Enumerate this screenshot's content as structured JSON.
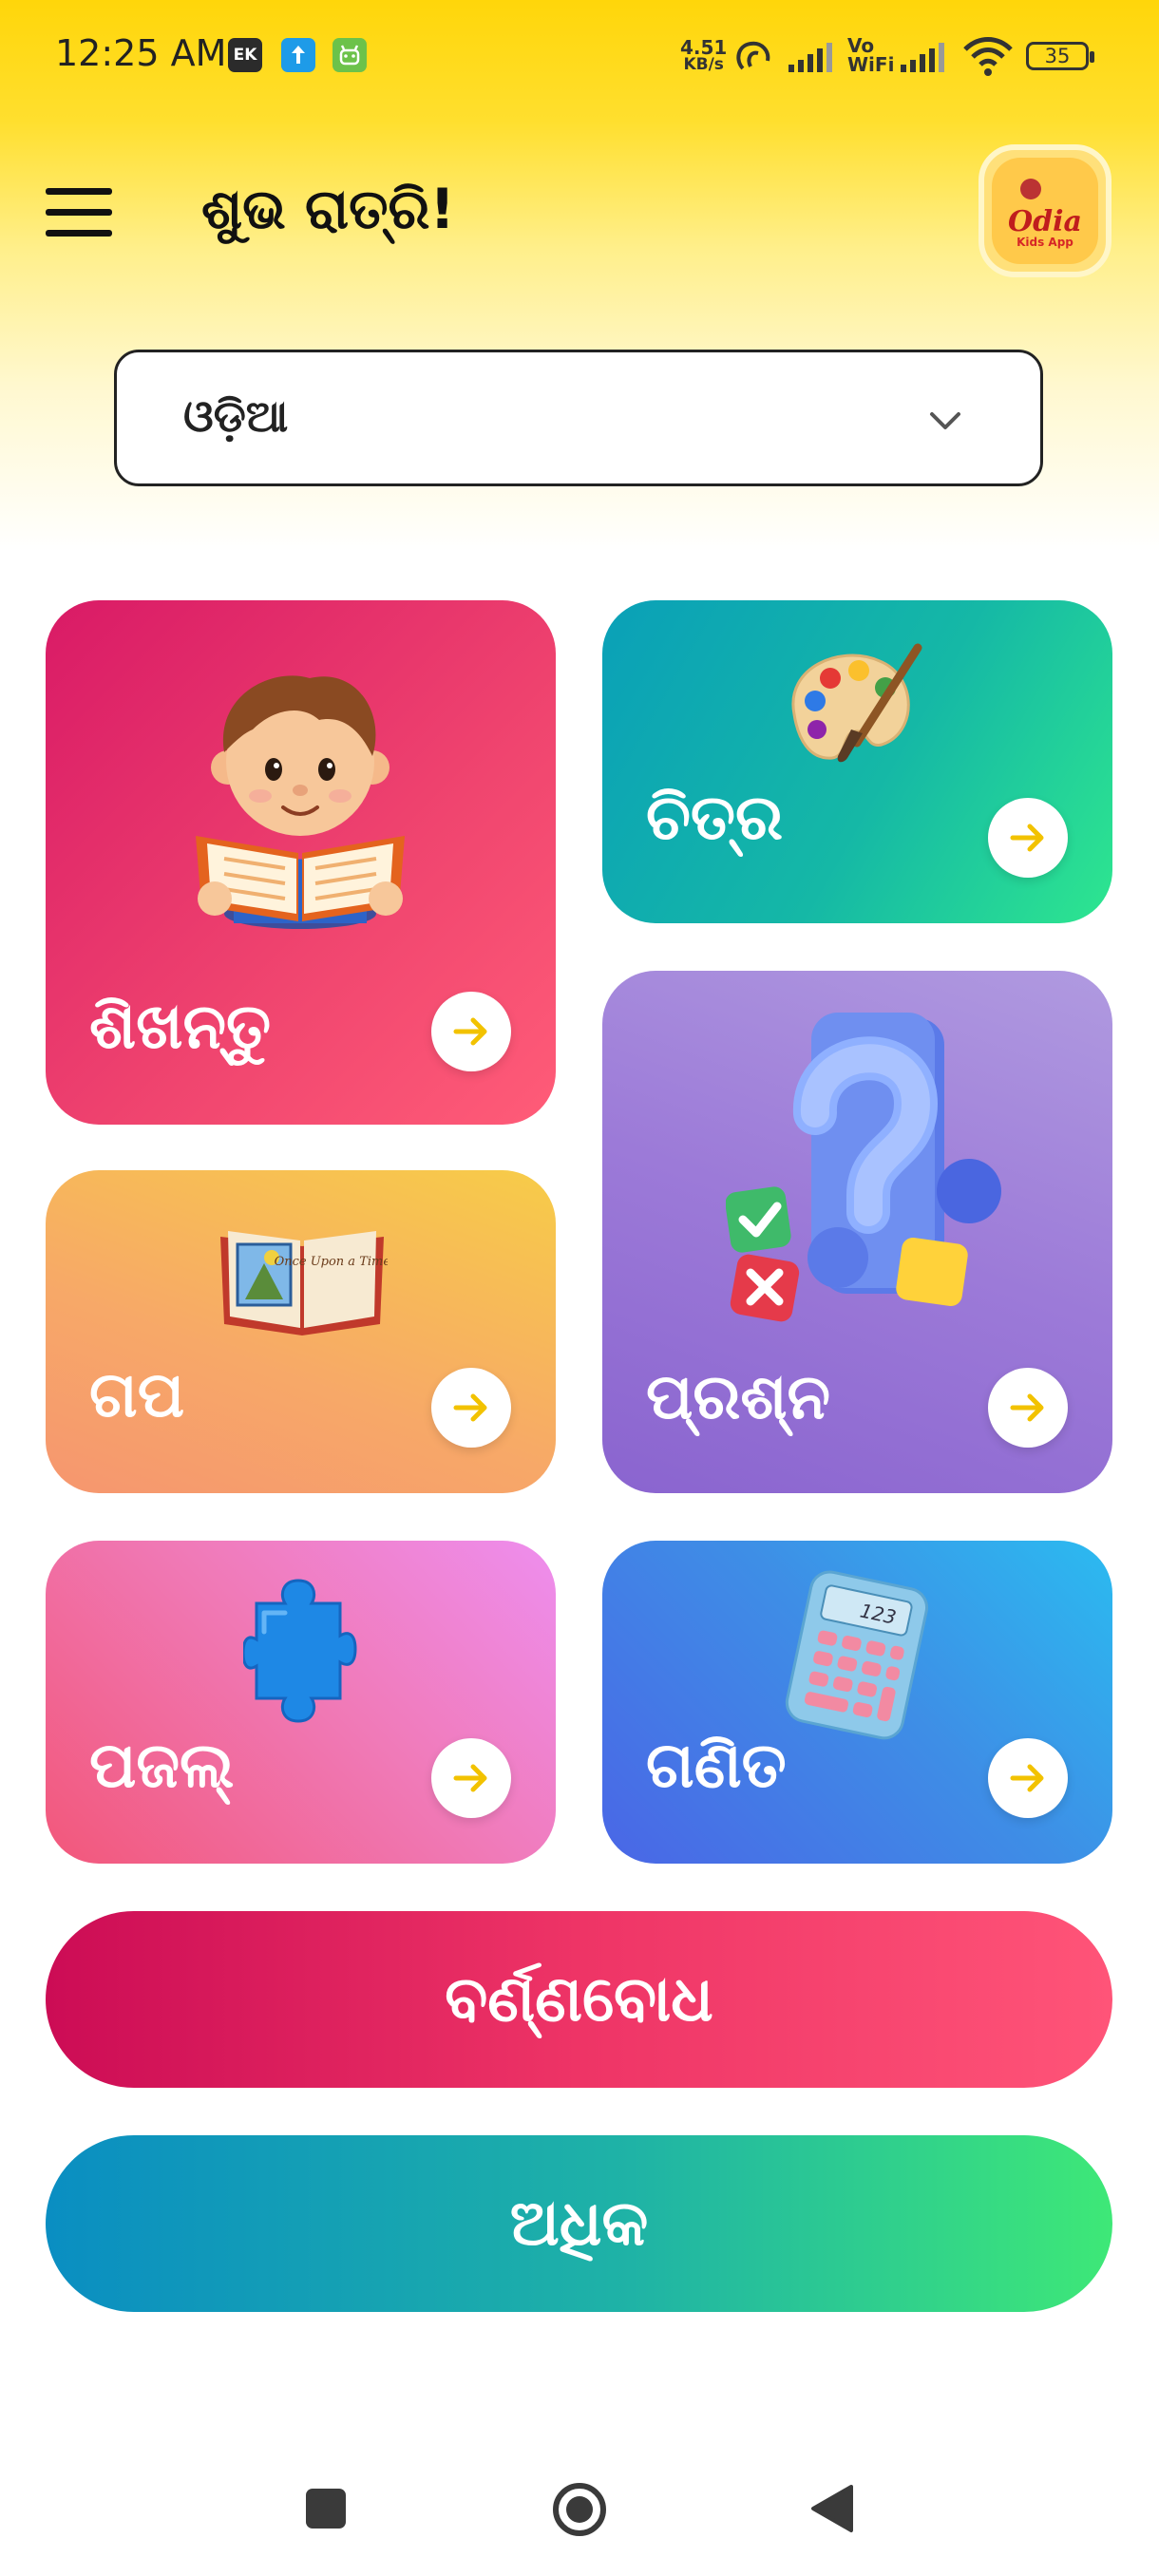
{
  "status_bar": {
    "time": "12:25 AM",
    "app_icon_1": "EK",
    "network_speed_value": "4.51",
    "network_speed_unit": "KB/s",
    "vo_label": "Vo",
    "wifi_label": "WiFi",
    "battery": "35",
    "icons": [
      "ek-app-icon",
      "upload-icon",
      "android-icon",
      "hotspot-icon",
      "signal-icon",
      "vowifi-icon",
      "wifi-icon",
      "battery-icon"
    ]
  },
  "header": {
    "greeting": "ଶୁଭ ରାତ୍ରି!",
    "logo_text": "Odia",
    "logo_subtext": "Kids App",
    "menu_icon": "hamburger-menu-icon"
  },
  "language_select": {
    "selected": "ଓଡ଼ିଆ",
    "icon": "chevron-down-icon"
  },
  "cards": [
    {
      "id": "shikhantu",
      "label": "ଶିଖନ୍ତୁ",
      "illustration": "boy-reading-book"
    },
    {
      "id": "chitra",
      "label": "ଚିତ୍ର",
      "illustration": "paint-palette"
    },
    {
      "id": "gapa",
      "label": "ଗପ",
      "illustration": "story-book",
      "illustration_text": "Once Upon a Time..."
    },
    {
      "id": "prashna",
      "label": "ପ୍ରଶ୍ନ",
      "illustration": "question-mark-quiz"
    },
    {
      "id": "pajal",
      "label": "ପଜଲ୍",
      "illustration": "puzzle-piece"
    },
    {
      "id": "ganita",
      "label": "ଗଣିତ",
      "illustration": "calculator",
      "illustration_text": "123"
    }
  ],
  "buttons": {
    "barnabodha": "ବର୍ଣ୍ଣବୋଧ",
    "adhika": "ଅଧିକ"
  },
  "colors": {
    "accent_yellow": "#ffd60a",
    "arrow_yellow": "#f2c200",
    "card_shikhantu": "#e52a68",
    "card_chitra": "#15b8a6",
    "card_gapa": "#f7b65a",
    "card_prashna": "#9c7ad8",
    "card_pajal": "#f07ab8",
    "card_ganita": "#3e8ee6"
  },
  "nav_bar": {
    "icons": [
      "recents-square-icon",
      "home-circle-icon",
      "back-triangle-icon"
    ]
  }
}
